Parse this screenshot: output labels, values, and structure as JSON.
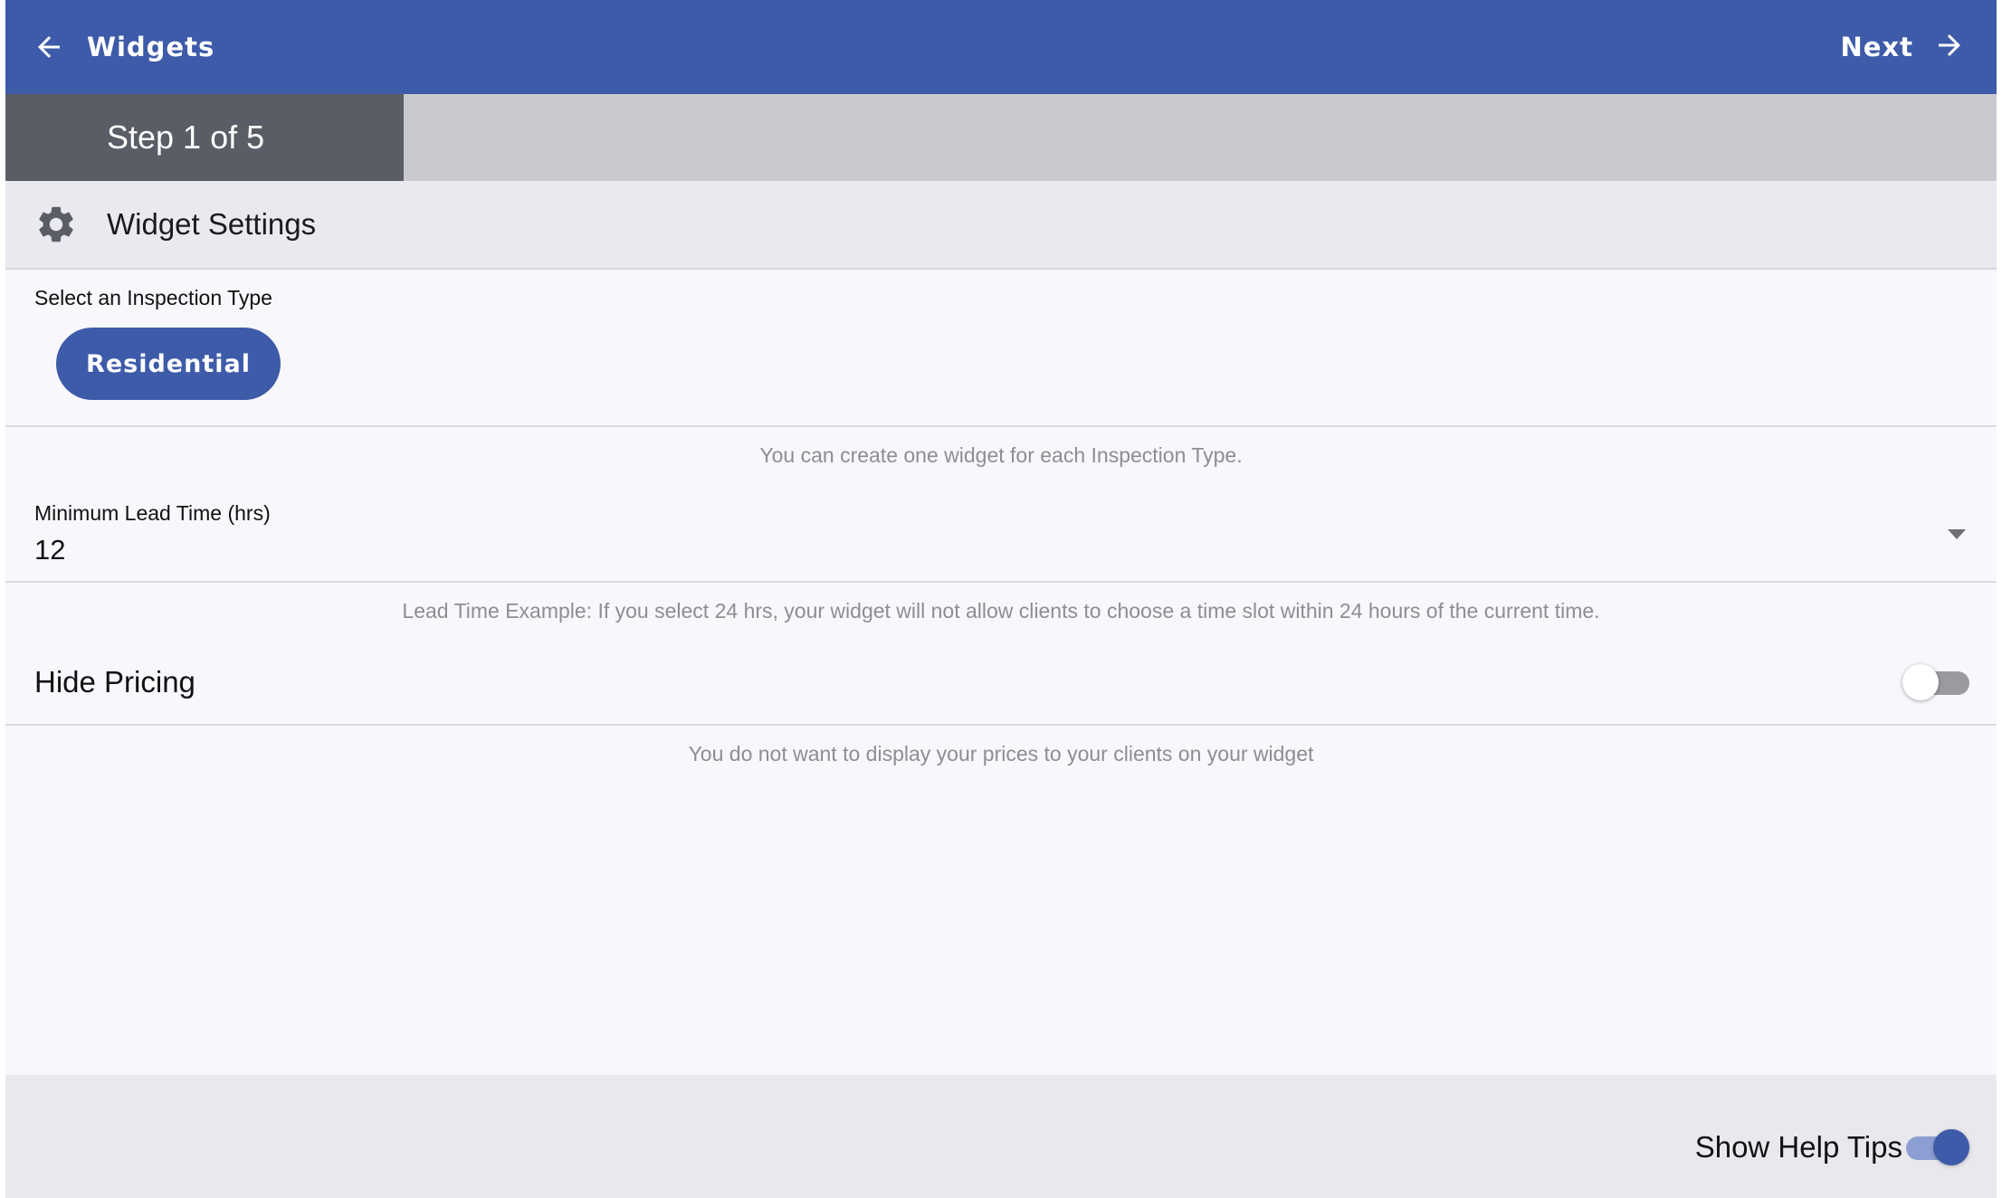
{
  "topbar": {
    "back_label": "Widgets",
    "next_label": "Next",
    "background": "#3d5ba8"
  },
  "progress": {
    "label": "Step 1 of 5",
    "current_step": 1,
    "total_steps": 5
  },
  "section": {
    "title": "Widget Settings",
    "icon": "gear-icon"
  },
  "inspection_type": {
    "label": "Select an Inspection Type",
    "options": [
      "Residential"
    ],
    "selected": "Residential",
    "help": "You can create one widget for each Inspection Type."
  },
  "lead_time": {
    "label": "Minimum Lead Time (hrs)",
    "value": "12",
    "help": "Lead Time Example: If you select 24 hrs, your widget will not allow clients to choose a time slot within 24 hours of the current time."
  },
  "hide_pricing": {
    "label": "Hide Pricing",
    "enabled": false,
    "help": "You do not want to display your prices to your clients on your widget"
  },
  "footer": {
    "help_tips_label": "Show Help Tips",
    "help_tips_enabled": true
  }
}
